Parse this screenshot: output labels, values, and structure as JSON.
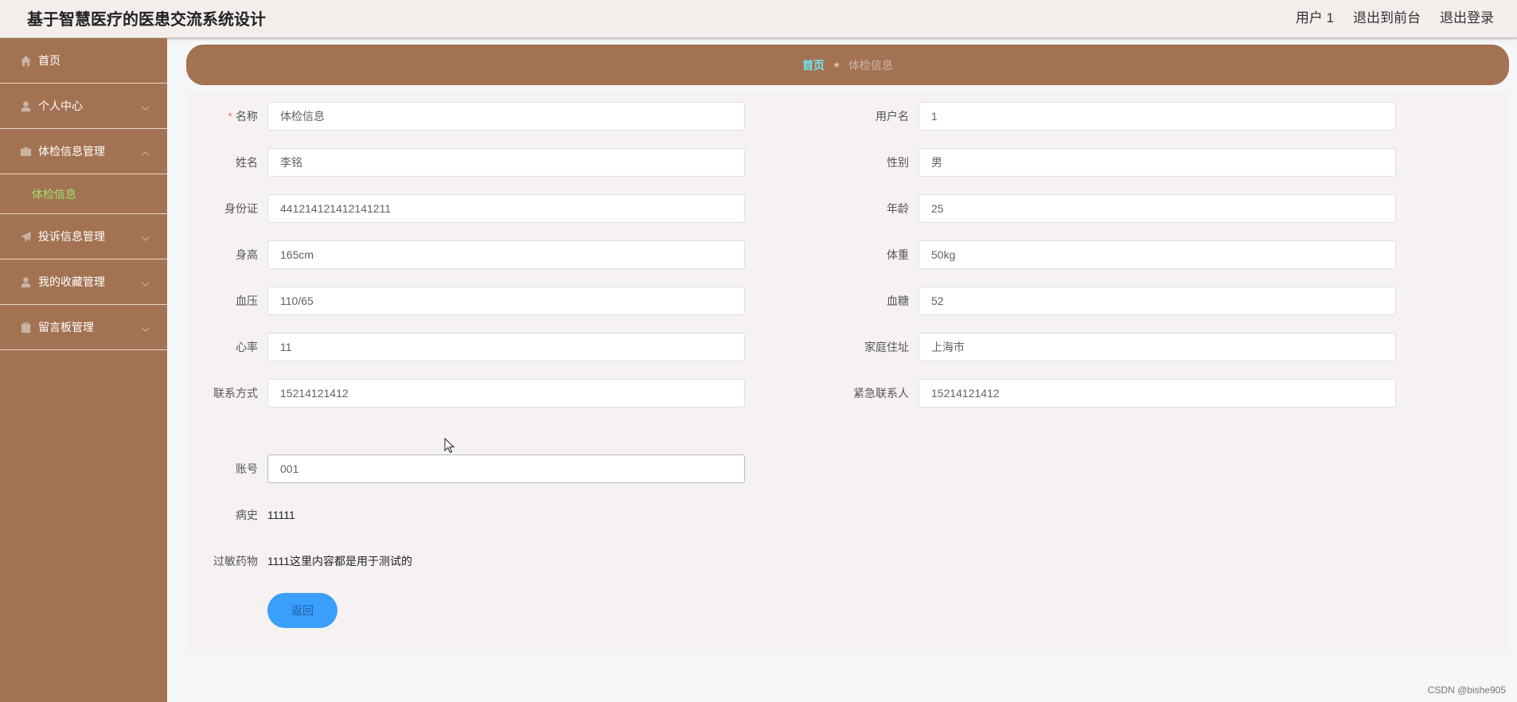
{
  "header": {
    "title": "基于智慧医疗的医患交流系统设计",
    "links": [
      "用户 1",
      "退出到前台",
      "退出登录"
    ]
  },
  "sidebar": {
    "items": [
      {
        "label": "首页",
        "icon": "home-icon"
      },
      {
        "label": "个人中心",
        "icon": "user-icon"
      },
      {
        "label": "体检信息管理",
        "icon": "briefcase-icon"
      },
      {
        "label": "投诉信息管理",
        "icon": "paper-plane-icon"
      },
      {
        "label": "我的收藏管理",
        "icon": "user-icon"
      },
      {
        "label": "留言板管理",
        "icon": "clipboard-icon"
      }
    ],
    "submenu_active": "体检信息"
  },
  "breadcrumb": {
    "home": "首页",
    "separator": "★",
    "current": "体检信息"
  },
  "form": {
    "name": {
      "label": "名称",
      "value": "体检信息"
    },
    "username": {
      "label": "用户名",
      "value": "1"
    },
    "realname": {
      "label": "姓名",
      "value": "李铭"
    },
    "gender": {
      "label": "性别",
      "value": "男"
    },
    "idcard": {
      "label": "身份证",
      "value": "441214121412141211"
    },
    "age": {
      "label": "年龄",
      "value": "25"
    },
    "height": {
      "label": "身高",
      "value": "165cm"
    },
    "weight": {
      "label": "体重",
      "value": "50kg"
    },
    "blood_pressure": {
      "label": "血压",
      "value": "110/65"
    },
    "blood_sugar": {
      "label": "血糖",
      "value": "52"
    },
    "heart_rate": {
      "label": "心率",
      "value": "11"
    },
    "address": {
      "label": "家庭住址",
      "value": "上海市"
    },
    "contact": {
      "label": "联系方式",
      "value": "15214121412"
    },
    "emergency_contact": {
      "label": "紧急联系人",
      "value": "15214121412"
    },
    "account": {
      "label": "账号",
      "value": "001"
    },
    "medical_history": {
      "label": "病史",
      "value": "11111"
    },
    "allergy": {
      "label": "过敏药物",
      "value": "1111这里内容都是用于测试的"
    },
    "back_label": "返回"
  },
  "watermark": "CSDN @bishe905"
}
